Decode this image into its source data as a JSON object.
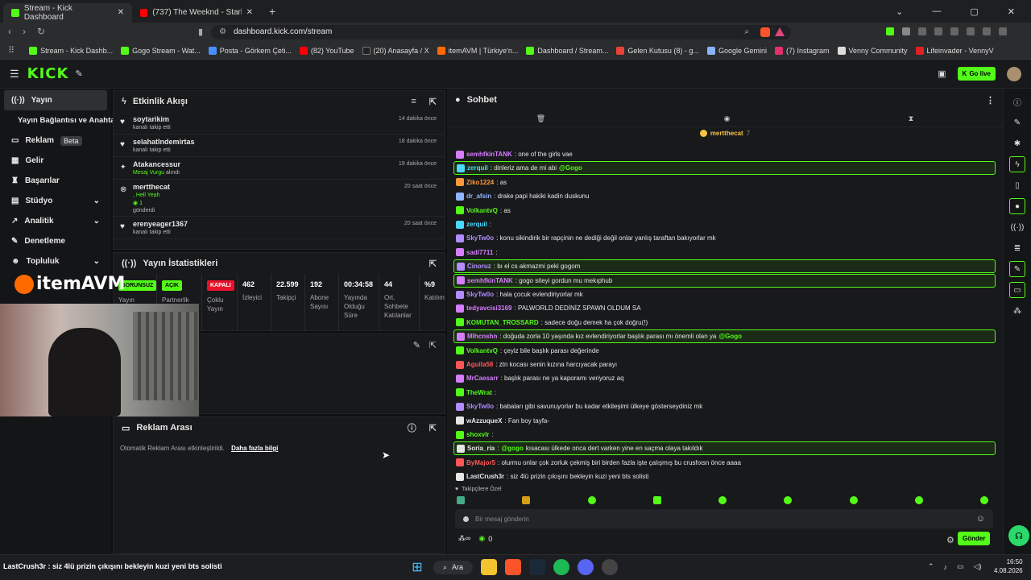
{
  "browser": {
    "tabs": [
      {
        "title": "Stream - Kick Dashboard",
        "active": true
      },
      {
        "title": "(737) The Weeknd - Starboy ft. Daft",
        "active": false
      }
    ],
    "url": "dashboard.kick.com/stream",
    "bookmarks": [
      "Stream - Kick Dashb...",
      "Gogo Stream - Wat...",
      "Posta - Görkem Çeti...",
      "(82) YouTube",
      "(20) Anasayfa / X",
      "itemAVM | Türkiye'n...",
      "Dashboard / Stream...",
      "Gelen Kutusu (8) - g...",
      "Google Gemini",
      "(7) Instagram",
      "Venny Community",
      "Lifeinvader - VennyV"
    ]
  },
  "header": {
    "logo": "KICK",
    "go_live": "Go live"
  },
  "sidebar": {
    "items": [
      {
        "label": "Yayın",
        "icon": "broadcast-icon",
        "active": true
      },
      {
        "label": "Yayın Bağlantısı ve Anahtarı",
        "icon": "",
        "active": false
      },
      {
        "label": "Reklam",
        "icon": "ad-icon",
        "badge": "Beta"
      },
      {
        "label": "Gelir",
        "icon": "money-icon"
      },
      {
        "label": "Başarılar",
        "icon": "trophy-icon"
      },
      {
        "label": "Stüdyo",
        "icon": "studio-icon",
        "chevron": true
      },
      {
        "label": "Analitik",
        "icon": "chart-icon",
        "chevron": true
      },
      {
        "label": "Denetleme",
        "icon": "wrench-icon"
      },
      {
        "label": "Topluluk",
        "icon": "community-icon",
        "chevron": true
      }
    ]
  },
  "activity": {
    "title": "Etkinlik Akışı",
    "events": [
      {
        "name": "soytarikim",
        "sub": "kanalı takip etti",
        "time": "14 dakika önce"
      },
      {
        "name": "selahatIndemirtas",
        "sub": "kanalı takip etti",
        "time": "18 dakika önce"
      },
      {
        "name": "Atakancessur",
        "sub": "Mesaj Vurgu",
        "sub2": " alındı",
        "time": "19 dakika önce"
      },
      {
        "name": "mertthecat",
        "sub": ", Hell Yeah",
        "sub2": "1",
        "sub3": "gönderdi",
        "time": "20 saat önce"
      },
      {
        "name": "erenyeager1367",
        "sub": "kanalı takip etti",
        "time": "20 saat önce"
      }
    ]
  },
  "stats": {
    "title": "Yayın İstatistikleri",
    "items": [
      {
        "value": "SORUNSUZ",
        "label": "Yayın",
        "color": "#53fc18"
      },
      {
        "value": "AÇIK",
        "label": "Partnerlik",
        "color": "#53fc18"
      },
      {
        "value": "KAPALI",
        "label": "Çoklu Yayın",
        "color": "#e8132b"
      },
      {
        "value": "462",
        "label": "İzleyici"
      },
      {
        "value": "22.599",
        "label": "Takipçi"
      },
      {
        "value": "192",
        "label": "Abone Sayısı"
      },
      {
        "value": "00:34:58",
        "label": "Yayında Olduğu Süre"
      },
      {
        "value": "44",
        "label": "Ort. Sohbete Katılanlar"
      },
      {
        "value": "%9",
        "label": "Katılım"
      }
    ]
  },
  "ad_break": {
    "title": "Reklam Arası",
    "text": "Otomatik Reklam Arası etkinleştirildi.",
    "link": "Daha fazla bilgi"
  },
  "overlay": {
    "brand": "itemAVM"
  },
  "chat": {
    "title": "Sohbet",
    "pinned_user": "mertthecat",
    "pinned_count": "7",
    "messages": [
      {
        "user": "semhfkinTANK",
        "color": "#d77dff",
        "text": ": one of the girls vae",
        "hl": false
      },
      {
        "user": "zerquil",
        "color": "#4ad9ff",
        "text": ": dinleriz ama de mi abi ",
        "mention": "@Gogo",
        "hl": true
      },
      {
        "user": "Ziko1224",
        "color": "#ff9a3c",
        "text": ": as",
        "hl": false
      },
      {
        "user": "dr_afsin",
        "color": "#8fb7ff",
        "text": ": drake papi hakiki kadin duskunu",
        "hl": false
      },
      {
        "user": "VolkantvQ",
        "color": "#53fc18",
        "text": ": as",
        "hl": false
      },
      {
        "user": "zerquil",
        "color": "#4ad9ff",
        "text": ":",
        "hl": false
      },
      {
        "user": "SkyTw0o",
        "color": "#b38cff",
        "text": ": konu sikindirik bir rapçinin ne dediği değil onlar yanlış taraftan bakıyorlar mk",
        "hl": false
      },
      {
        "user": "sadi7711",
        "color": "#d77dff",
        "text": ":",
        "hl": false
      },
      {
        "user": "Cinoruz",
        "color": "#b38cff",
        "text": ": bı el cs akmazmi peki gogom",
        "hl": true
      },
      {
        "user": "semhfkinTANK",
        "color": "#d77dff",
        "text": ": gogo siteyi gordun mu mekıphub",
        "hl": true
      },
      {
        "user": "SkyTw0o",
        "color": "#b38cff",
        "text": ": hala çocuk evlendiriyorlar mk",
        "hl": false
      },
      {
        "user": "tedyavcisi3169",
        "color": "#d77dff",
        "text": ": PALWORLD DEDİNİZ SPAWN OLDUM SA",
        "hl": false
      },
      {
        "user": "KOMUTAN_TROSSARD",
        "color": "#53fc18",
        "text": ": sadece doğu demek ha çok doğru(!)",
        "hl": false
      },
      {
        "user": "Mlhcnshn",
        "color": "#d77dff",
        "text": ": doğuda zorla 10 yaşında kız evlendiriyorlar başlık parası mı önemli olan ya ",
        "mention": "@Gogo",
        "hl": true
      },
      {
        "user": "VolkantvQ",
        "color": "#53fc18",
        "text": ": çeyiz bile başlık parası değerinde",
        "hl": false
      },
      {
        "user": "Aguila58",
        "color": "#ff5757",
        "text": ": ztn kocası senin kızına harcıyacak parayı",
        "hl": false
      },
      {
        "user": "MrCaesarr",
        "color": "#d77dff",
        "text": ": başlık parası ne ya kaporamı veriyoruz aq",
        "hl": false
      },
      {
        "user": "TheWrat",
        "color": "#53fc18",
        "text": ":",
        "hl": false
      },
      {
        "user": "SkyTw0o",
        "color": "#b38cff",
        "text": ": babaları gibi savunuyorlar bu kadar etkileşimi ülkeye gösterseydiniz mk",
        "hl": false
      },
      {
        "user": "wAzzuqueX",
        "color": "#e6e6e6",
        "text": ": Fan boy tayfa-",
        "hl": false
      },
      {
        "user": "shoxvlr",
        "color": "#53fc18",
        "text": ":",
        "hl": false
      },
      {
        "user": "Soria_ria",
        "color": "#e6e6e6",
        "text": ": ",
        "mention": "@gogo",
        "text2": " kısacası ülkede onca dert varken yine en saçma olaya takıldık",
        "hl": true
      },
      {
        "user": "ByMajor5",
        "color": "#ff5757",
        "text": ": olurmu onlar çok zorluk çekmiş biri birden fazla işte çalışmış bu crushxsn önce aaaa",
        "hl": false
      },
      {
        "user": "LastCrush3r",
        "color": "#e6e6e6",
        "text": ": siz 4lü prizin çıkışını bekleyin kuzi yeni bts solisti",
        "hl": false
      }
    ],
    "followers_only": "Takipçilere Özel",
    "placeholder": "Bir mesaj gönderin",
    "points": "0",
    "send_label": "Gönder"
  },
  "taskbar": {
    "search": "Ara",
    "ticker": "LastCrush3r : siz 4lü prizin çıkışını bekleyin kuzi yeni bts solisti",
    "time": "16:50",
    "date": "4.08.2026"
  }
}
